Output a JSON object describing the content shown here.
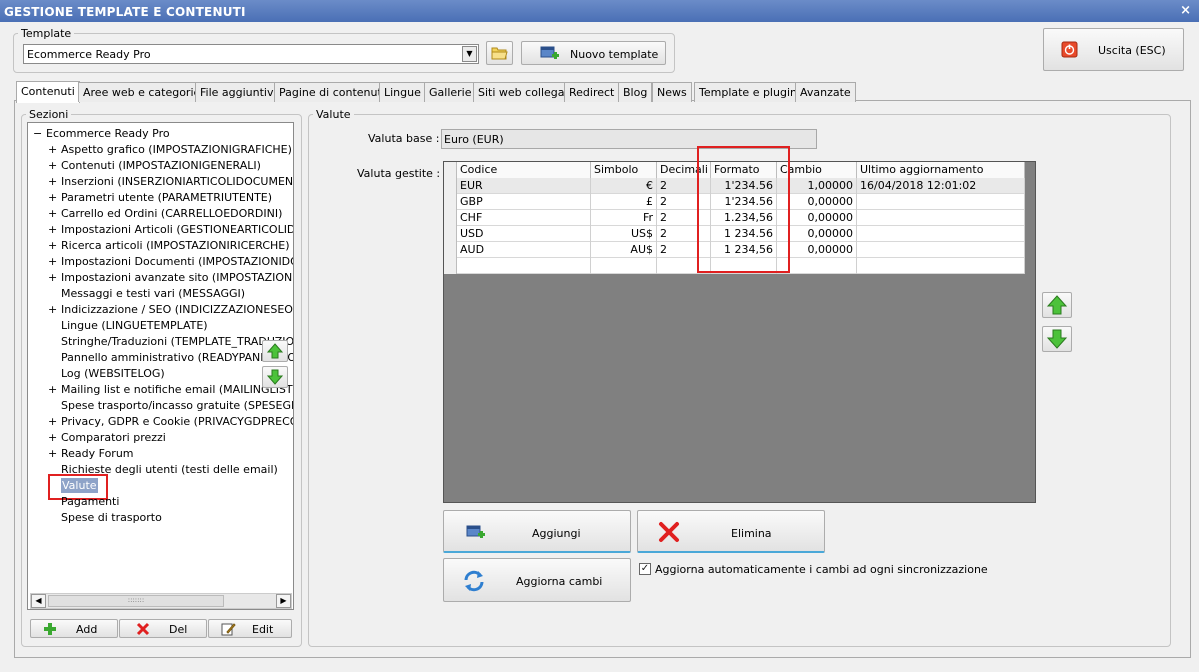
{
  "window": {
    "title": "GESTIONE TEMPLATE E CONTENUTI",
    "close_glyph": "×"
  },
  "template_group": {
    "legend": "Template",
    "selected": "Ecommerce Ready Pro",
    "new_template_label": "Nuovo template"
  },
  "exit_button": {
    "label": "Uscita (ESC)"
  },
  "tabs": [
    "Contenuti",
    "Aree web e categorie",
    "File aggiuntivi",
    "Pagine di contenuti",
    "Lingue",
    "Gallerie",
    "Siti web collegati",
    "Redirect",
    "Blog",
    "News",
    "Template e plugins",
    "Avanzate"
  ],
  "sections": {
    "legend": "Sezioni",
    "root": "Ecommerce Ready Pro",
    "items": [
      {
        "label": "Aspetto grafico (IMPOSTAZIONIGRAFICHE)",
        "expandable": true
      },
      {
        "label": "Contenuti (IMPOSTAZIONIGENERALI)",
        "expandable": true
      },
      {
        "label": "Inserzioni (INSERZIONIARTICOLIDOCUMENTI)",
        "expandable": true
      },
      {
        "label": "Parametri utente (PARAMETRIUTENTE)",
        "expandable": true
      },
      {
        "label": "Carrello ed Ordini (CARRELLOEDORDINI)",
        "expandable": true
      },
      {
        "label": "Impostazioni Articoli (GESTIONEARTICOLIDOCUMENTI)",
        "expandable": true
      },
      {
        "label": "Ricerca articoli (IMPOSTAZIONIRICERCHE)",
        "expandable": true
      },
      {
        "label": "Impostazioni Documenti (IMPOSTAZIONIDOCUMENTI)",
        "expandable": true
      },
      {
        "label": "Impostazioni avanzate sito (IMPOSTAZIONIAVANZATE)",
        "expandable": true
      },
      {
        "label": "Messaggi e testi vari (MESSAGGI)",
        "expandable": false
      },
      {
        "label": "Indicizzazione / SEO (INDICIZZAZIONESEO)",
        "expandable": true
      },
      {
        "label": "Lingue (LINGUETEMPLATE)",
        "expandable": false
      },
      {
        "label": "Stringhe/Traduzioni (TEMPLATE_TRADUZIONI)",
        "expandable": false
      },
      {
        "label": "Pannello amministrativo (READYPANNELLO)",
        "expandable": false
      },
      {
        "label": "Log (WEBSITELOG)",
        "expandable": false
      },
      {
        "label": "Mailing list e notifiche email (MAILINGLIST)",
        "expandable": true
      },
      {
        "label": "Spese trasporto/incasso gratuite (SPESEGRATUITE)",
        "expandable": false
      },
      {
        "label": "Privacy, GDPR e Cookie (PRIVACYGDPRECOOKIE)",
        "expandable": true
      },
      {
        "label": "Comparatori prezzi",
        "expandable": true
      },
      {
        "label": "Ready Forum",
        "expandable": true
      },
      {
        "label": "Richieste degli utenti (testi delle email)",
        "expandable": false
      },
      {
        "label": "Valute",
        "expandable": false,
        "selected": true
      },
      {
        "label": "Pagamenti",
        "expandable": false
      },
      {
        "label": "Spese di trasporto",
        "expandable": false
      }
    ],
    "add_label": "Add",
    "del_label": "Del",
    "edit_label": "Edit"
  },
  "valute": {
    "legend": "Valute",
    "base_label": "Valuta base :",
    "base_value": "Euro (EUR)",
    "managed_label": "Valuta gestite :",
    "columns": [
      "Codice",
      "Simbolo",
      "Decimali",
      "Formato",
      "Cambio",
      "Ultimo aggiornamento"
    ],
    "rows": [
      [
        "EUR",
        "€",
        "2",
        "1'234.56",
        "1,00000",
        "16/04/2018 12:01:02"
      ],
      [
        "GBP",
        "£",
        "2",
        "1'234.56",
        "0,00000",
        ""
      ],
      [
        "CHF",
        "Fr",
        "2",
        "1.234,56",
        "0,00000",
        ""
      ],
      [
        "USD",
        "US$",
        "2",
        "1 234.56",
        "0,00000",
        ""
      ],
      [
        "AUD",
        "AU$",
        "2",
        "1 234,56",
        "0,00000",
        ""
      ]
    ],
    "add_label": "Aggiungi",
    "delete_label": "Elimina",
    "refresh_label": "Aggiorna cambi",
    "auto_update_label": "Aggiorna automaticamente i cambi ad ogni sincronizzazione",
    "auto_update_checked": true
  },
  "colors": {
    "accent_red": "#e02020",
    "title_blue": "#4a6fb5",
    "grid_bg": "#808080",
    "green_arrow": "#3aa830"
  }
}
